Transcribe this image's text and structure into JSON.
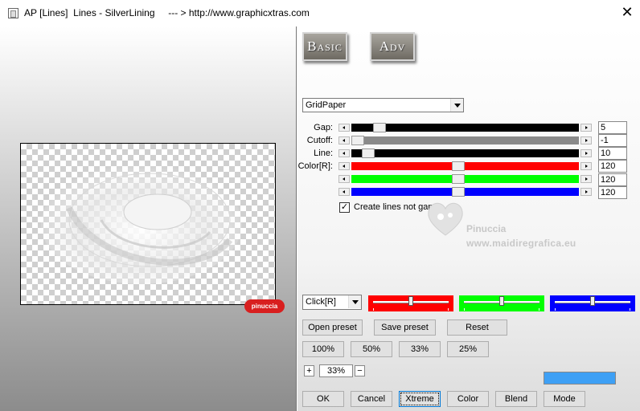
{
  "window": {
    "title": "AP [Lines]  Lines - SilverLining     --- > http://www.graphicxtras.com",
    "close_glyph": "✕"
  },
  "tabs": {
    "basic": "Basic",
    "adv": "Adv"
  },
  "filter": {
    "selected": "GridPaper"
  },
  "params": {
    "gap": {
      "label": "Gap:",
      "value": "5",
      "fraction": 0.1
    },
    "cutoff": {
      "label": "Cutoff:",
      "value": "-1",
      "fraction": 0.0
    },
    "line": {
      "label": "Line:",
      "value": "10",
      "fraction": 0.05
    },
    "color_label": "Color[R]:",
    "color_r": {
      "value": "120",
      "fraction": 0.47,
      "color": "#ff0000"
    },
    "color_g": {
      "value": "120",
      "fraction": 0.47,
      "color": "#00ff00"
    },
    "color_b": {
      "value": "120",
      "fraction": 0.47,
      "color": "#0000ff"
    }
  },
  "checkbox": {
    "label": "Create lines not gaps",
    "checked": true,
    "glyph": "✓"
  },
  "watermark": {
    "name": "Pinuccia",
    "url": "www.maidiregrafica.eu"
  },
  "badge": {
    "text": "pinuccia"
  },
  "mode_select": {
    "value": "Click[R]"
  },
  "color_pickers": [
    {
      "color": "#ff0000",
      "fraction": 0.5
    },
    {
      "color": "#00ff00",
      "fraction": 0.5
    },
    {
      "color": "#0000ff",
      "fraction": 0.5
    }
  ],
  "buttons": {
    "open_preset": "Open preset",
    "save_preset": "Save preset",
    "reset": "Reset",
    "zoom_100": "100%",
    "zoom_50": "50%",
    "zoom_33": "33%",
    "zoom_25": "25%",
    "zoom_plus": "+",
    "zoom_minus": "−",
    "ok": "OK",
    "cancel": "Cancel",
    "xtreme": "Xtreme",
    "color": "Color",
    "blend": "Blend",
    "mode": "Mode"
  },
  "zoom": {
    "value": "33%"
  },
  "preview_color": "#3ea0f5"
}
